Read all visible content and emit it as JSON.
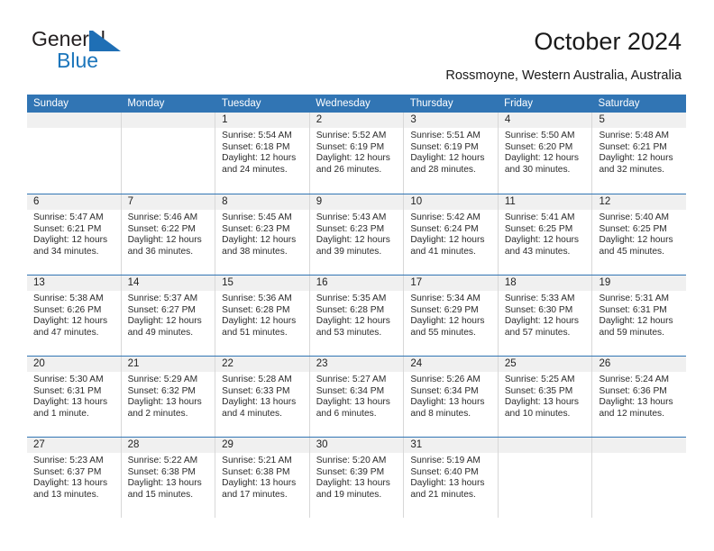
{
  "brand": {
    "name_part1": "General",
    "name_part2": "Blue",
    "mark": "triangle-logo"
  },
  "header": {
    "title": "October 2024",
    "subtitle": "Rossmoyne, Western Australia, Australia"
  },
  "colors": {
    "header_blue": "#3175b4",
    "brand_blue": "#1b75bb",
    "daynum_band": "#f0f0f0"
  },
  "weekdays": [
    "Sunday",
    "Monday",
    "Tuesday",
    "Wednesday",
    "Thursday",
    "Friday",
    "Saturday"
  ],
  "labels": {
    "sunrise": "Sunrise:",
    "sunset": "Sunset:",
    "daylight": "Daylight:"
  },
  "weeks": [
    [
      {
        "day": "",
        "sunrise": "",
        "sunset": "",
        "daylight1": "",
        "daylight2": ""
      },
      {
        "day": "",
        "sunrise": "",
        "sunset": "",
        "daylight1": "",
        "daylight2": ""
      },
      {
        "day": "1",
        "sunrise": "Sunrise: 5:54 AM",
        "sunset": "Sunset: 6:18 PM",
        "daylight1": "Daylight: 12 hours",
        "daylight2": "and 24 minutes."
      },
      {
        "day": "2",
        "sunrise": "Sunrise: 5:52 AM",
        "sunset": "Sunset: 6:19 PM",
        "daylight1": "Daylight: 12 hours",
        "daylight2": "and 26 minutes."
      },
      {
        "day": "3",
        "sunrise": "Sunrise: 5:51 AM",
        "sunset": "Sunset: 6:19 PM",
        "daylight1": "Daylight: 12 hours",
        "daylight2": "and 28 minutes."
      },
      {
        "day": "4",
        "sunrise": "Sunrise: 5:50 AM",
        "sunset": "Sunset: 6:20 PM",
        "daylight1": "Daylight: 12 hours",
        "daylight2": "and 30 minutes."
      },
      {
        "day": "5",
        "sunrise": "Sunrise: 5:48 AM",
        "sunset": "Sunset: 6:21 PM",
        "daylight1": "Daylight: 12 hours",
        "daylight2": "and 32 minutes."
      }
    ],
    [
      {
        "day": "6",
        "sunrise": "Sunrise: 5:47 AM",
        "sunset": "Sunset: 6:21 PM",
        "daylight1": "Daylight: 12 hours",
        "daylight2": "and 34 minutes."
      },
      {
        "day": "7",
        "sunrise": "Sunrise: 5:46 AM",
        "sunset": "Sunset: 6:22 PM",
        "daylight1": "Daylight: 12 hours",
        "daylight2": "and 36 minutes."
      },
      {
        "day": "8",
        "sunrise": "Sunrise: 5:45 AM",
        "sunset": "Sunset: 6:23 PM",
        "daylight1": "Daylight: 12 hours",
        "daylight2": "and 38 minutes."
      },
      {
        "day": "9",
        "sunrise": "Sunrise: 5:43 AM",
        "sunset": "Sunset: 6:23 PM",
        "daylight1": "Daylight: 12 hours",
        "daylight2": "and 39 minutes."
      },
      {
        "day": "10",
        "sunrise": "Sunrise: 5:42 AM",
        "sunset": "Sunset: 6:24 PM",
        "daylight1": "Daylight: 12 hours",
        "daylight2": "and 41 minutes."
      },
      {
        "day": "11",
        "sunrise": "Sunrise: 5:41 AM",
        "sunset": "Sunset: 6:25 PM",
        "daylight1": "Daylight: 12 hours",
        "daylight2": "and 43 minutes."
      },
      {
        "day": "12",
        "sunrise": "Sunrise: 5:40 AM",
        "sunset": "Sunset: 6:25 PM",
        "daylight1": "Daylight: 12 hours",
        "daylight2": "and 45 minutes."
      }
    ],
    [
      {
        "day": "13",
        "sunrise": "Sunrise: 5:38 AM",
        "sunset": "Sunset: 6:26 PM",
        "daylight1": "Daylight: 12 hours",
        "daylight2": "and 47 minutes."
      },
      {
        "day": "14",
        "sunrise": "Sunrise: 5:37 AM",
        "sunset": "Sunset: 6:27 PM",
        "daylight1": "Daylight: 12 hours",
        "daylight2": "and 49 minutes."
      },
      {
        "day": "15",
        "sunrise": "Sunrise: 5:36 AM",
        "sunset": "Sunset: 6:28 PM",
        "daylight1": "Daylight: 12 hours",
        "daylight2": "and 51 minutes."
      },
      {
        "day": "16",
        "sunrise": "Sunrise: 5:35 AM",
        "sunset": "Sunset: 6:28 PM",
        "daylight1": "Daylight: 12 hours",
        "daylight2": "and 53 minutes."
      },
      {
        "day": "17",
        "sunrise": "Sunrise: 5:34 AM",
        "sunset": "Sunset: 6:29 PM",
        "daylight1": "Daylight: 12 hours",
        "daylight2": "and 55 minutes."
      },
      {
        "day": "18",
        "sunrise": "Sunrise: 5:33 AM",
        "sunset": "Sunset: 6:30 PM",
        "daylight1": "Daylight: 12 hours",
        "daylight2": "and 57 minutes."
      },
      {
        "day": "19",
        "sunrise": "Sunrise: 5:31 AM",
        "sunset": "Sunset: 6:31 PM",
        "daylight1": "Daylight: 12 hours",
        "daylight2": "and 59 minutes."
      }
    ],
    [
      {
        "day": "20",
        "sunrise": "Sunrise: 5:30 AM",
        "sunset": "Sunset: 6:31 PM",
        "daylight1": "Daylight: 13 hours",
        "daylight2": "and 1 minute."
      },
      {
        "day": "21",
        "sunrise": "Sunrise: 5:29 AM",
        "sunset": "Sunset: 6:32 PM",
        "daylight1": "Daylight: 13 hours",
        "daylight2": "and 2 minutes."
      },
      {
        "day": "22",
        "sunrise": "Sunrise: 5:28 AM",
        "sunset": "Sunset: 6:33 PM",
        "daylight1": "Daylight: 13 hours",
        "daylight2": "and 4 minutes."
      },
      {
        "day": "23",
        "sunrise": "Sunrise: 5:27 AM",
        "sunset": "Sunset: 6:34 PM",
        "daylight1": "Daylight: 13 hours",
        "daylight2": "and 6 minutes."
      },
      {
        "day": "24",
        "sunrise": "Sunrise: 5:26 AM",
        "sunset": "Sunset: 6:34 PM",
        "daylight1": "Daylight: 13 hours",
        "daylight2": "and 8 minutes."
      },
      {
        "day": "25",
        "sunrise": "Sunrise: 5:25 AM",
        "sunset": "Sunset: 6:35 PM",
        "daylight1": "Daylight: 13 hours",
        "daylight2": "and 10 minutes."
      },
      {
        "day": "26",
        "sunrise": "Sunrise: 5:24 AM",
        "sunset": "Sunset: 6:36 PM",
        "daylight1": "Daylight: 13 hours",
        "daylight2": "and 12 minutes."
      }
    ],
    [
      {
        "day": "27",
        "sunrise": "Sunrise: 5:23 AM",
        "sunset": "Sunset: 6:37 PM",
        "daylight1": "Daylight: 13 hours",
        "daylight2": "and 13 minutes."
      },
      {
        "day": "28",
        "sunrise": "Sunrise: 5:22 AM",
        "sunset": "Sunset: 6:38 PM",
        "daylight1": "Daylight: 13 hours",
        "daylight2": "and 15 minutes."
      },
      {
        "day": "29",
        "sunrise": "Sunrise: 5:21 AM",
        "sunset": "Sunset: 6:38 PM",
        "daylight1": "Daylight: 13 hours",
        "daylight2": "and 17 minutes."
      },
      {
        "day": "30",
        "sunrise": "Sunrise: 5:20 AM",
        "sunset": "Sunset: 6:39 PM",
        "daylight1": "Daylight: 13 hours",
        "daylight2": "and 19 minutes."
      },
      {
        "day": "31",
        "sunrise": "Sunrise: 5:19 AM",
        "sunset": "Sunset: 6:40 PM",
        "daylight1": "Daylight: 13 hours",
        "daylight2": "and 21 minutes."
      },
      {
        "day": "",
        "sunrise": "",
        "sunset": "",
        "daylight1": "",
        "daylight2": ""
      },
      {
        "day": "",
        "sunrise": "",
        "sunset": "",
        "daylight1": "",
        "daylight2": ""
      }
    ]
  ]
}
